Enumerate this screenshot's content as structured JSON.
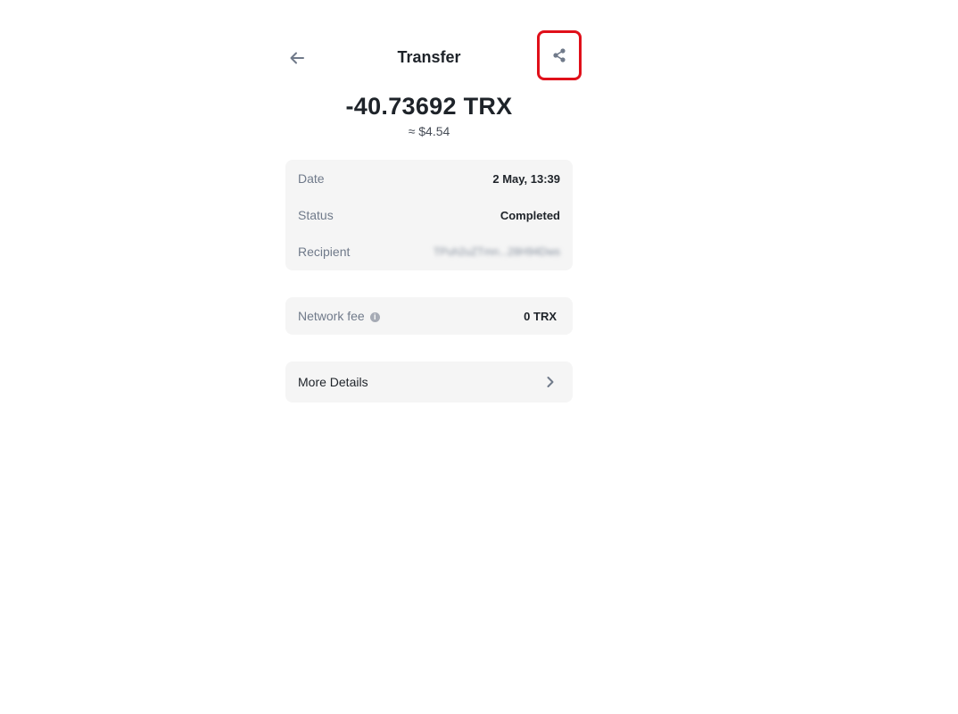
{
  "header": {
    "back_icon": "arrow-left-icon",
    "title": "Transfer",
    "share_icon": "share-icon",
    "highlight_color": "#e0101a"
  },
  "summary": {
    "amount": "-40.73692 TRX",
    "fiat": "≈ $4.54"
  },
  "details": {
    "date_label": "Date",
    "date_value": "2 May, 13:39",
    "status_label": "Status",
    "status_value": "Completed",
    "recipient_label": "Recipient",
    "recipient_value": "TPuh2uZTmn...28H94Dws"
  },
  "fee": {
    "label": "Network fee",
    "info_icon": "info-icon",
    "value": "0 TRX"
  },
  "more": {
    "label": "More Details",
    "chevron_icon": "chevron-right-icon"
  },
  "colors": {
    "card_bg": "#f5f5f5",
    "text_primary": "#1e2329",
    "text_secondary": "#707a8a"
  }
}
